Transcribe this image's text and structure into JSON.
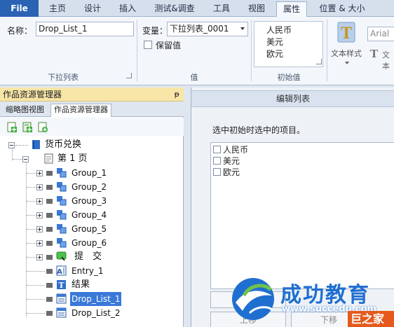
{
  "ribbon_tabs": [
    "File",
    "主页",
    "设计",
    "插入",
    "测试&调查",
    "工具",
    "视图",
    "属性",
    "位置 & 大小"
  ],
  "ribbon": {
    "name_label": "名称：",
    "name_value": "Drop_List_1",
    "group1_label": "下拉列表",
    "variable_label": "变量：",
    "variable_value": "下拉列表_0001",
    "keep_value_label": "保留值",
    "group2_label": "值",
    "initial_values": [
      "人民币",
      "美元",
      "欧元"
    ],
    "group3_label": "初始值",
    "text_style_label": "文本样式",
    "font_value": "Arial",
    "text_partial": "文本"
  },
  "panel": {
    "title": "作品资源管理器",
    "pin": "ᵽ",
    "tabs": [
      "缩略图视图",
      "作品资源管理器"
    ],
    "tree": {
      "root": "货币兑换",
      "page": "第 1 页",
      "groups": [
        "Group_1",
        "Group_2",
        "Group_3",
        "Group_4",
        "Group_5",
        "Group_6"
      ],
      "submit": "提　交",
      "entry": "Entry_1",
      "result": "结果",
      "drop1": "Drop_List_1",
      "drop2": "Drop_List_2"
    }
  },
  "dialog": {
    "title": "编辑列表",
    "prompt": "选中初始时选中的项目。",
    "items": [
      "人民币",
      "美元",
      "欧元"
    ],
    "up_label": "上移",
    "down_label": "下移"
  },
  "watermark": {
    "brand": "成功教育",
    "url": "www.succedu.com",
    "corner": "巨之家"
  },
  "colors": {
    "file_tab": "#2a62b4",
    "panel_title": "#f8e6a8",
    "selection": "#3a79d8",
    "watermark_blue": "#1f6fd0"
  }
}
